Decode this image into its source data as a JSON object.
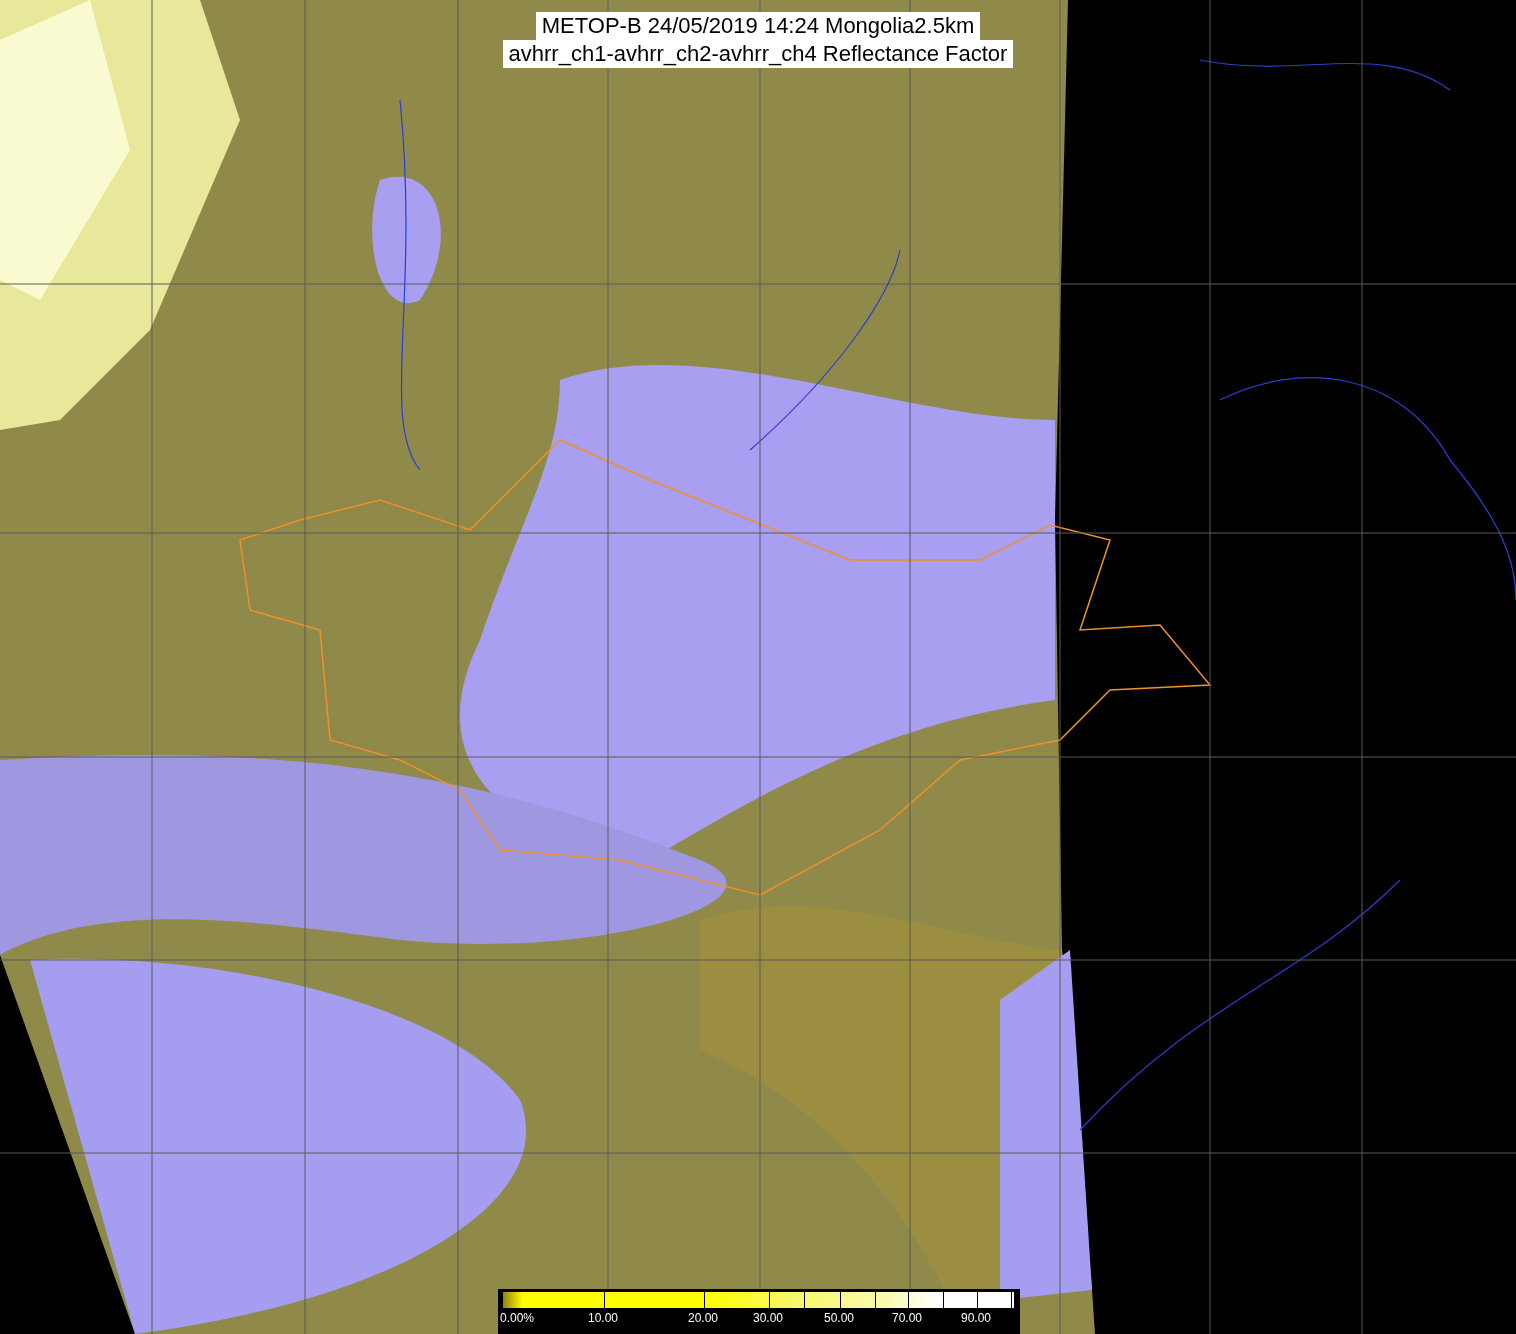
{
  "title_lines": [
    "METOP-B 24/05/2019 14:24 Mongolia2.5km",
    "avhrr_ch1-avhrr_ch2-avhrr_ch4 Reflectance Factor"
  ],
  "color_scale": {
    "labels": [
      "0.00%",
      "10.00",
      "20.00",
      "30.00",
      "50.00",
      "70.00",
      "90.00"
    ]
  }
}
